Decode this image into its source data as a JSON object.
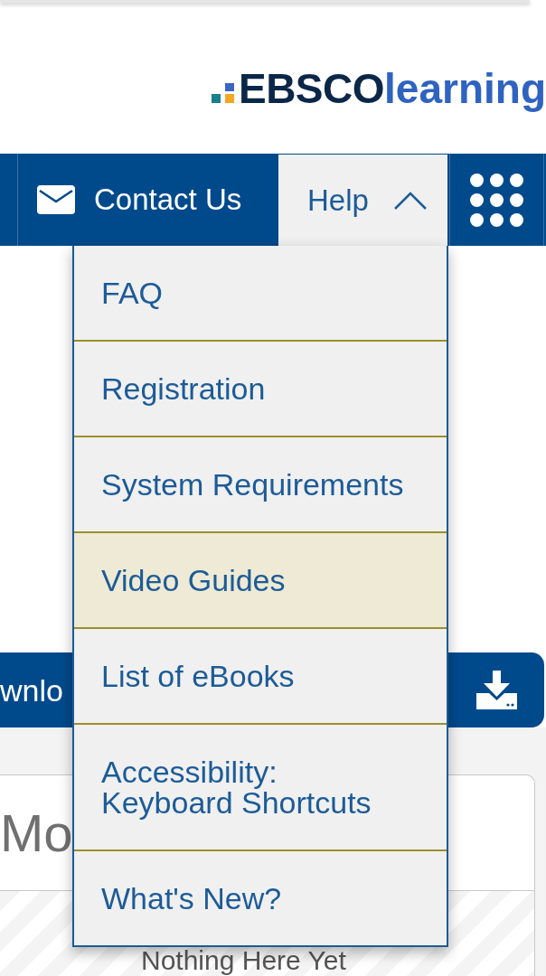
{
  "logo": {
    "brand": "EBSCO",
    "product": "learning"
  },
  "nav": {
    "items": [
      {
        "kind": "contact",
        "label": "Contact Us"
      },
      {
        "kind": "help",
        "label": "Help",
        "expanded": true
      },
      {
        "kind": "apps"
      }
    ]
  },
  "help_menu": {
    "items": [
      {
        "label": "FAQ",
        "highlighted": false
      },
      {
        "label": "Registration",
        "highlighted": false
      },
      {
        "label": "System Requirements",
        "highlighted": false
      },
      {
        "label": "Video Guides",
        "highlighted": true
      },
      {
        "label": "List of eBooks",
        "highlighted": false
      },
      {
        "label": "Accessibility: Keyboard Shortcuts",
        "highlighted": false
      },
      {
        "label": "What's New?",
        "highlighted": false
      }
    ]
  },
  "download_bar": {
    "label": "wnlo"
  },
  "card": {
    "title": "Mo",
    "empty_message": "Nothing Here Yet"
  }
}
